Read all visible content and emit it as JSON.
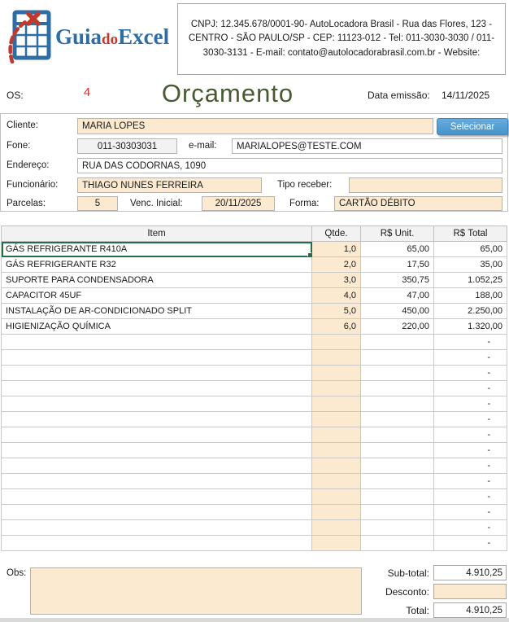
{
  "colors": {
    "input_fill": "#fbe9d0",
    "readonly_fill": "#f2f2f2",
    "button_blue": "#4d9ad2",
    "selection_green": "#1e7145",
    "title_green": "#475a31",
    "os_number_red": "#d02e2e",
    "logo_blue": "#2e6da4",
    "logo_red": "#c0392b"
  },
  "logo": {
    "guia": "Guia",
    "do": "do",
    "excel": "Excel"
  },
  "company_box": {
    "text": "CNPJ: 12.345.678/0001-90- AutoLocadora Brasil - Rua das Flores, 123 - CENTRO - SÃO PAULO/SP - CEP: 11123-012 - Tel: 011-3030-3030 / 011-3030-3131 - E-mail: contato@autolocadorabrasil.com.br - Website:"
  },
  "header": {
    "os_label": "OS:",
    "os_number": "4",
    "title": "Orçamento",
    "date_label": "Data emissão:",
    "date_value": "14/11/2025"
  },
  "form": {
    "cliente_label": "Cliente:",
    "cliente_value": "MARIA LOPES",
    "selecionar_button": "Selecionar",
    "fone_label": "Fone:",
    "fone_value": "011-30303031",
    "email_label": "e-mail:",
    "email_value": "MARIALOPES@TESTE.COM",
    "endereco_label": "Endereço:",
    "endereco_value": "RUA DAS CODORNAS, 1090",
    "funcionario_label": "Funcionário:",
    "funcionario_value": "THIAGO NUNES FERREIRA",
    "tipo_receber_label": "Tipo receber:",
    "tipo_receber_value": "",
    "parcelas_label": "Parcelas:",
    "parcelas_value": "5",
    "venc_inicial_label": "Venc. Inicial:",
    "venc_inicial_value": "20/11/2025",
    "forma_label": "Forma:",
    "forma_value": "CARTÃO DÉBITO"
  },
  "table": {
    "headers": [
      "Item",
      "Qtde.",
      "R$ Unit.",
      "R$ Total"
    ],
    "rows": [
      {
        "item": "GÁS REFRIGERANTE R410A",
        "qty": "1,0",
        "unit": "65,00",
        "total": "65,00"
      },
      {
        "item": "GÁS REFRIGERANTE R32",
        "qty": "2,0",
        "unit": "17,50",
        "total": "35,00"
      },
      {
        "item": "SUPORTE PARA CONDENSADORA",
        "qty": "3,0",
        "unit": "350,75",
        "total": "1.052,25"
      },
      {
        "item": "CAPACITOR 45UF",
        "qty": "4,0",
        "unit": "47,00",
        "total": "188,00"
      },
      {
        "item": "INSTALAÇÃO DE AR-CONDICIONADO SPLIT",
        "qty": "5,0",
        "unit": "450,00",
        "total": "2.250,00"
      },
      {
        "item": "HIGIENIZAÇÃO QUÍMICA",
        "qty": "6,0",
        "unit": "220,00",
        "total": "1.320,00"
      }
    ],
    "empty_row_count": 14,
    "empty_total_placeholder": "-"
  },
  "footer": {
    "obs_label": "Obs:",
    "obs_value": "",
    "subtotal_label": "Sub-total:",
    "subtotal_value": "4.910,25",
    "discount_label": "Desconto:",
    "discount_value": "",
    "total_label": "Total:",
    "total_value": "4.910,25"
  }
}
